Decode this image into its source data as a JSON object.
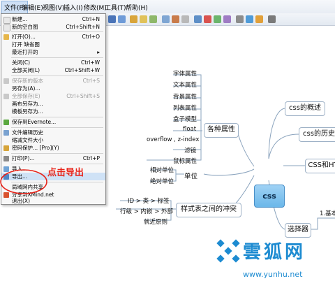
{
  "menubar": {
    "items": [
      "文件(F)",
      "编辑(E)",
      "视图(V)",
      "插入(I)",
      "修改(M)",
      "工具(T)",
      "帮助(H)"
    ]
  },
  "file_menu": {
    "items": [
      {
        "label": "新建...",
        "shortcut": "Ctrl+N",
        "disabled": false
      },
      {
        "label": "新的空白图",
        "shortcut": "Ctrl+Shift+N",
        "disabled": false
      },
      {
        "label": "打开(O)...",
        "shortcut": "Ctrl+O",
        "disabled": false
      },
      {
        "label": "打开 缺省图",
        "shortcut": "",
        "disabled": false
      },
      {
        "label": "最近打开的",
        "shortcut": "",
        "disabled": false,
        "submenu": true
      },
      {
        "label": "关闭(C)",
        "shortcut": "Ctrl+W",
        "disabled": false
      },
      {
        "label": "全部关闭(L)",
        "shortcut": "Ctrl+Shift+W",
        "disabled": false
      },
      {
        "label": "保存新的版本",
        "shortcut": "Ctrl+S",
        "disabled": true
      },
      {
        "label": "另存为(A)...",
        "shortcut": "",
        "disabled": false
      },
      {
        "label": "全部保存(E)",
        "shortcut": "Ctrl+Shift+S",
        "disabled": true
      },
      {
        "label": "画布另存为...",
        "shortcut": "",
        "disabled": false
      },
      {
        "label": "模板另存为...",
        "shortcut": "",
        "disabled": false
      },
      {
        "label": "保存到Evernote...",
        "shortcut": "",
        "disabled": false
      },
      {
        "label": "文件编辑历史",
        "shortcut": "",
        "disabled": false
      },
      {
        "label": "缩减文件大小",
        "shortcut": "",
        "disabled": false
      },
      {
        "label": "密码保护... [Pro](Y)",
        "shortcut": "",
        "disabled": false
      },
      {
        "label": "打印(P)...",
        "shortcut": "Ctrl+P",
        "disabled": false
      },
      {
        "label": "导入...",
        "shortcut": "",
        "disabled": false
      },
      {
        "label": "导出...",
        "shortcut": "",
        "disabled": false,
        "highlighted": true
      },
      {
        "label": "局域网内共享",
        "shortcut": "",
        "disabled": false
      },
      {
        "label": "分享到XMind.net",
        "shortcut": "",
        "disabled": false
      },
      {
        "label": "退出(X)",
        "shortcut": "",
        "disabled": false
      }
    ]
  },
  "annotation": "点击导出",
  "mindmap": {
    "central": "css",
    "right_topics": [
      "css的概述",
      "css的历史",
      "CSS和HT",
      "选择器"
    ],
    "selector_child": "1.基本",
    "left_topics": {
      "properties": "各种属性",
      "property_items": [
        "字体属性",
        "文本属性",
        "背景属性",
        "列表属性",
        "盒子模型",
        "float",
        "overflow , z-index",
        "滤镜",
        "鼠标属性"
      ],
      "units": "单位",
      "unit_items": [
        "相对单位",
        "绝对单位"
      ],
      "conflict": "样式表之间的冲突",
      "conflict_items": [
        "ID > 类 > 标签",
        "行级 > 内嵌 > 外部",
        "就近原则"
      ]
    }
  },
  "watermark": {
    "text": "雲狐网",
    "url": "www.yunhu.net"
  }
}
